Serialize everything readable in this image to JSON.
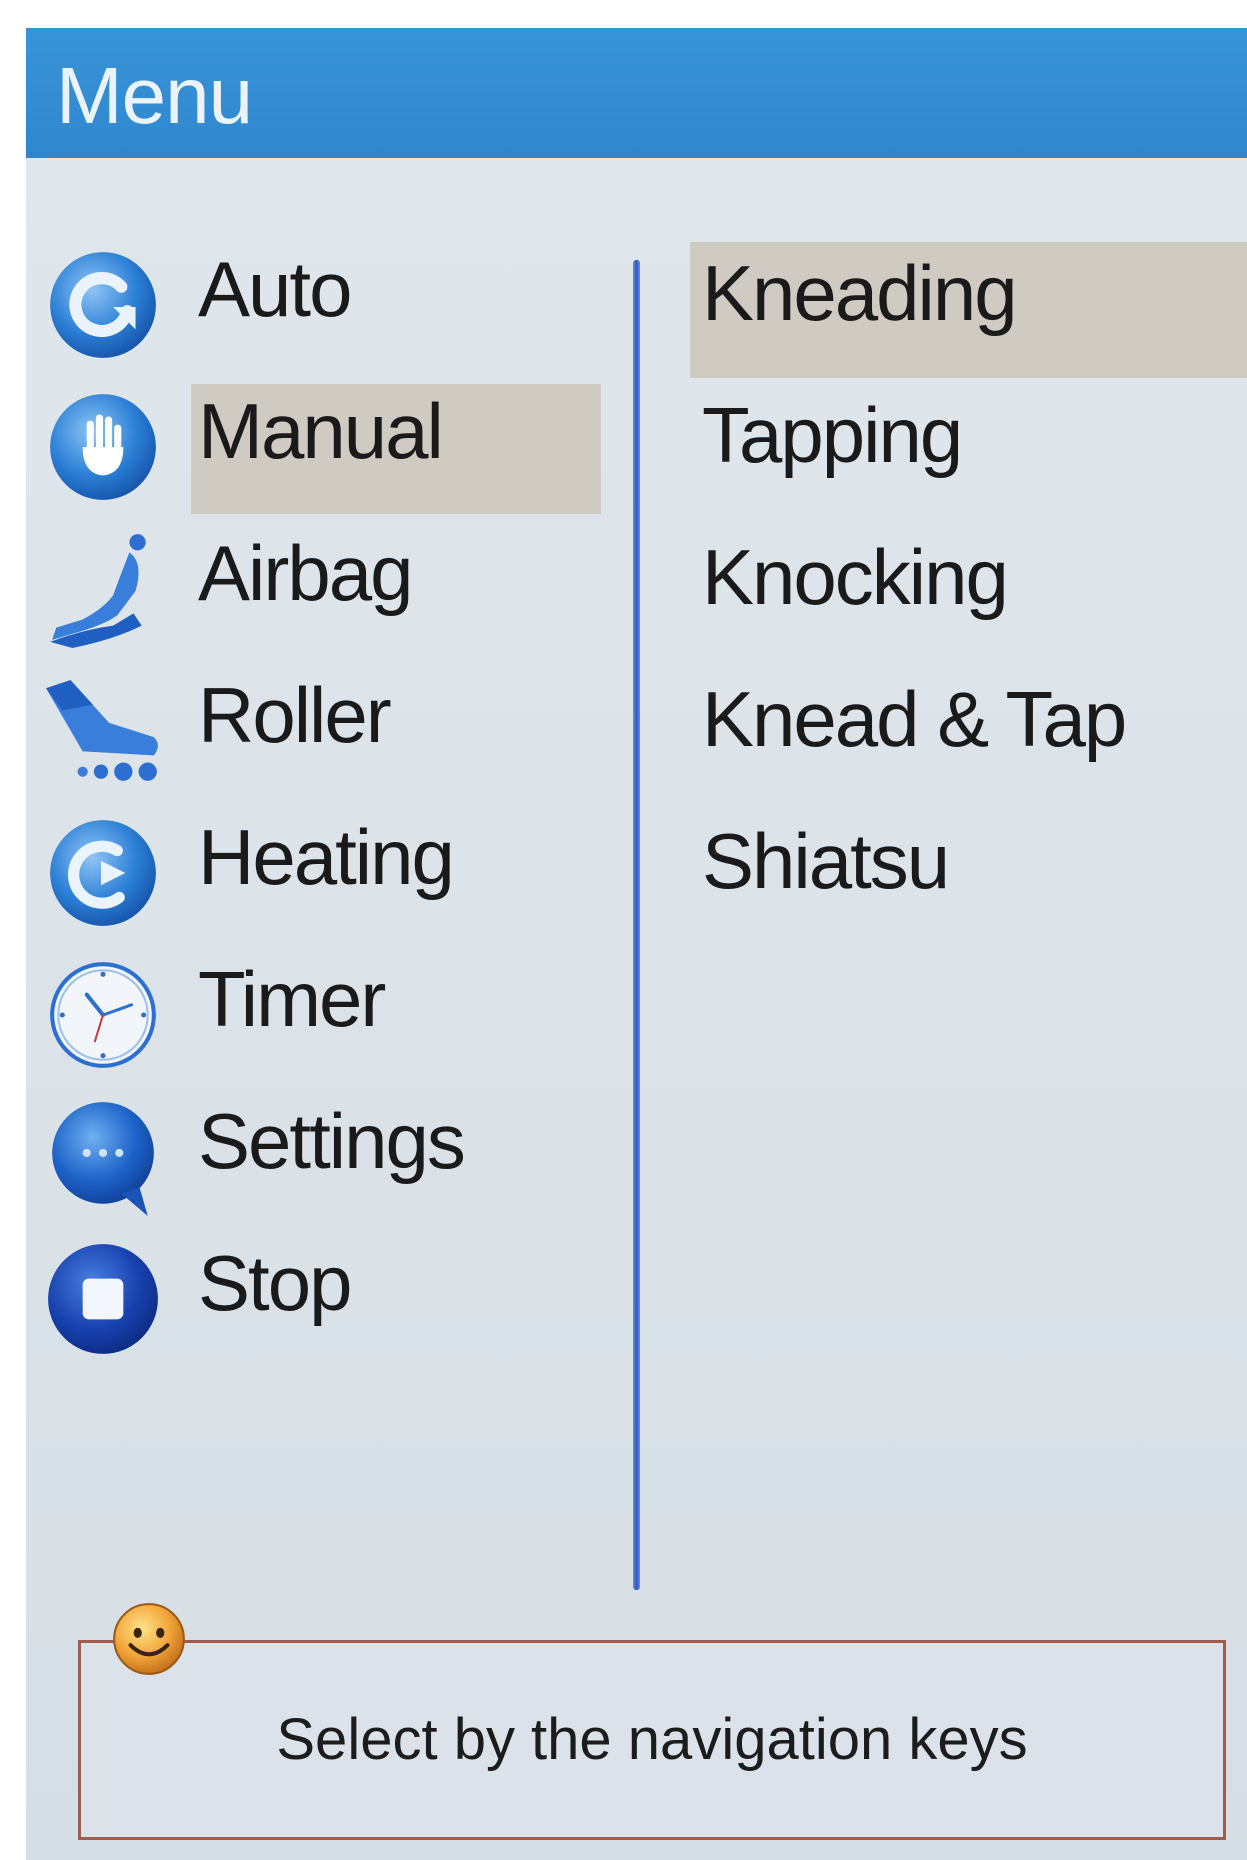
{
  "header": {
    "title": "Menu"
  },
  "left_menu": {
    "selected": "Manual",
    "items": [
      {
        "label": "Auto",
        "icon": "refresh-icon"
      },
      {
        "label": "Manual",
        "icon": "hand-icon"
      },
      {
        "label": "Airbag",
        "icon": "massage-chair-icon"
      },
      {
        "label": "Roller",
        "icon": "foot-roller-icon"
      },
      {
        "label": "Heating",
        "icon": "heating-icon"
      },
      {
        "label": "Timer",
        "icon": "clock-icon"
      },
      {
        "label": "Settings",
        "icon": "chat-bubble-icon"
      },
      {
        "label": "Stop",
        "icon": "stop-icon"
      }
    ]
  },
  "sub_menu": {
    "selected": "Kneading",
    "items": [
      {
        "label": "Kneading"
      },
      {
        "label": "Tapping"
      },
      {
        "label": "Knocking"
      },
      {
        "label": "Knead & Tap"
      },
      {
        "label": "Shiatsu"
      }
    ]
  },
  "hint": {
    "text": "Select by the navigation keys",
    "icon": "smiley-icon"
  },
  "colors": {
    "title_bar": "#2f86cd",
    "highlight": "#cfcbc2",
    "divider": "#2d57c4",
    "hint_border": "#a05a50"
  }
}
